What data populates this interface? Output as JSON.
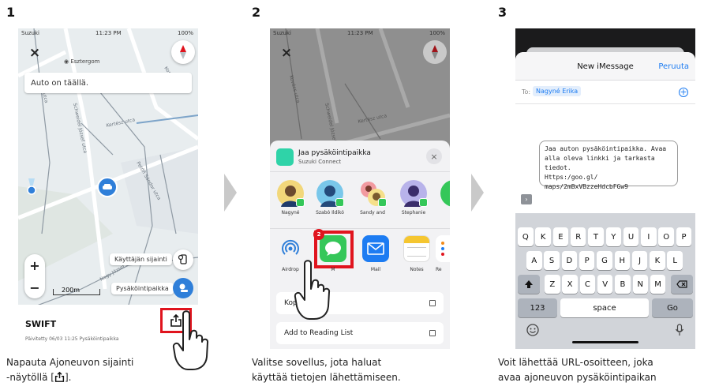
{
  "steps": [
    {
      "number": "1",
      "caption": [
        "Napauta Ajoneuvon sijainti",
        "-näytöllä [",
        "]."
      ]
    },
    {
      "number": "2",
      "caption": [
        "Valitse sovellus, jota haluat",
        "käyttää tietojen lähettämiseen."
      ]
    },
    {
      "number": "3",
      "caption": [
        "Voit lähettää URL-osoitteen, joka",
        "avaa ajoneuvon pysäköintipaikan"
      ]
    }
  ],
  "status_bar": {
    "carrier": "Suzuki",
    "time": "11:23 PM",
    "battery": "100%"
  },
  "map_screen": {
    "place_label": "Esztergom",
    "banner": "Auto on täällä.",
    "user_location_label": "Käyttäjän sijainti",
    "parking_label": "Pysäköintipaikka",
    "scale": "200m",
    "zoom_in": "+",
    "zoom_out": "−",
    "vehicle_name": "SWIFT",
    "updated": "Päivitetty 06/03 11:25 Pysäköintipaikka",
    "street_labels": [
      "Kovács utca",
      "Kertész utca",
      "Schweidel József utca",
      "Petőfi Sándor utca",
      "Kossuth utca",
      "Nagy József utca"
    ]
  },
  "share_sheet": {
    "title": "Jaa pysäköintipaikka",
    "subtitle": "Suzuki Connect",
    "contacts": [
      "Nagyné",
      "Szabó Ildikó",
      "Sandy and",
      "Stephanie"
    ],
    "apps": [
      {
        "name": "Airdrop",
        "badge": ""
      },
      {
        "name": "M",
        "badge": "2"
      },
      {
        "name": "Mail",
        "badge": ""
      },
      {
        "name": "Notes",
        "badge": ""
      },
      {
        "name": "Re",
        "badge": ""
      }
    ],
    "actions": [
      "Kop.",
      "Add to Reading List"
    ]
  },
  "imessage": {
    "header_title": "New iMessage",
    "cancel": "Peruuta",
    "to_label": "To:",
    "recipient": "Nagyné Erika",
    "message": [
      "Jaa auton pysäköintipaikka. Avaa",
      "alla oleva linkki ja tarkasta tiedot.",
      "Https:/goo.gl/",
      "maps/2mBxVBzzeHdcbFGw9"
    ],
    "keyboard": {
      "row1": [
        "Q",
        "K",
        "E",
        "R",
        "T",
        "Y",
        "U",
        "I",
        "O",
        "P"
      ],
      "row2": [
        "A",
        "S",
        "D",
        "P",
        "G",
        "H",
        "J",
        "K",
        "L"
      ],
      "row3": [
        "Z",
        "X",
        "C",
        "V",
        "B",
        "N",
        "M"
      ],
      "numbers": "123",
      "space": "space",
      "go": "Go"
    }
  },
  "colors": {
    "accent_blue": "#2f7fd9",
    "highlight_red": "#e0141e",
    "messages_green": "#35c759"
  }
}
